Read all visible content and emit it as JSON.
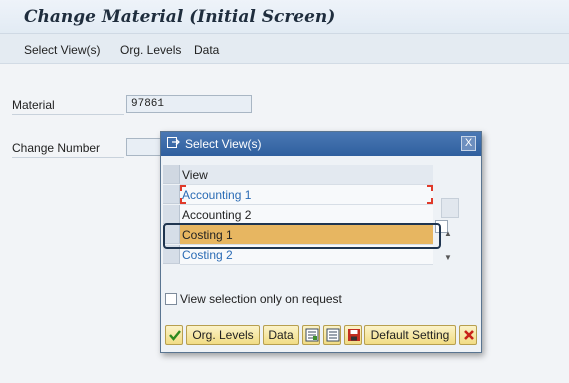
{
  "title": "Change Material (Initial Screen)",
  "menu": {
    "items": [
      "Select View(s)",
      "Org. Levels",
      "Data"
    ]
  },
  "form": {
    "material_label": "Material",
    "material_value": "97861",
    "change_number_label": "Change Number",
    "change_number_value": ""
  },
  "dialog": {
    "title": "Select View(s)",
    "close_label": "X",
    "column_header": "View",
    "rows": [
      {
        "label": "Accounting 1",
        "style": "blue"
      },
      {
        "label": "Accounting 2",
        "style": "normal"
      },
      {
        "label": "Costing 1",
        "style": "highlighted"
      },
      {
        "label": "Costing 2",
        "style": "blue"
      }
    ],
    "checkbox_label": "View selection only on request",
    "buttons": {
      "org_levels": "Org. Levels",
      "data": "Data",
      "default_setting": "Default Setting"
    }
  },
  "colors": {
    "highlight": "#e7b661",
    "header_blue": "#2f5f9e",
    "link_blue": "#2a6bb5",
    "button_yellow": "#f1dc84"
  }
}
